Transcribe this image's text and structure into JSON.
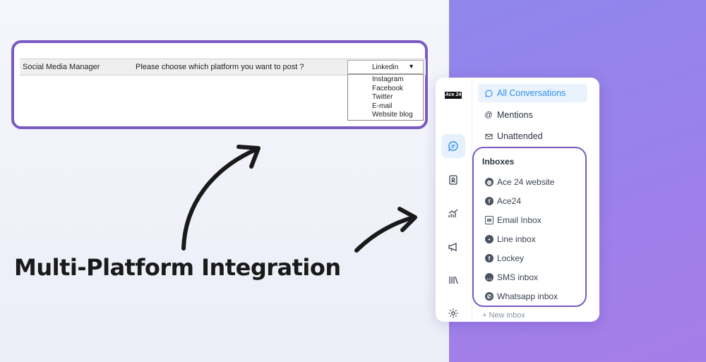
{
  "sheet": {
    "role": "Social Media Manager",
    "question": "Please choose which platform you want to post ?",
    "selected": "Linkedin",
    "options": [
      "Instagram",
      "Facebook",
      "Twitter",
      "E-mail",
      "Website blog"
    ]
  },
  "headline": "Multi-Platform Integration",
  "app": {
    "logo": "Ace 24",
    "rail_icons": [
      "chat-icon",
      "contacts-icon",
      "reports-icon",
      "campaigns-icon",
      "library-icon",
      "settings-icon"
    ],
    "nav": {
      "all_conversations": "All Conversations",
      "mentions": "Mentions",
      "unattended": "Unattended"
    },
    "inboxes": {
      "title": "Inboxes",
      "items": [
        {
          "label": "Ace 24 website",
          "icon": "globe-icon"
        },
        {
          "label": "Ace24",
          "icon": "facebook-icon"
        },
        {
          "label": "Email Inbox",
          "icon": "email-icon"
        },
        {
          "label": "Line inbox",
          "icon": "line-icon"
        },
        {
          "label": "Lockey",
          "icon": "facebook-icon"
        },
        {
          "label": "SMS inbox",
          "icon": "sms-icon"
        },
        {
          "label": "Whatsapp inbox",
          "icon": "whatsapp-icon"
        }
      ],
      "new_inbox": "+ New inbox"
    }
  },
  "colors": {
    "accent_purple": "#7a5bc4",
    "active_blue": "#2f8ceb",
    "right_bg": "#9d80ea"
  }
}
